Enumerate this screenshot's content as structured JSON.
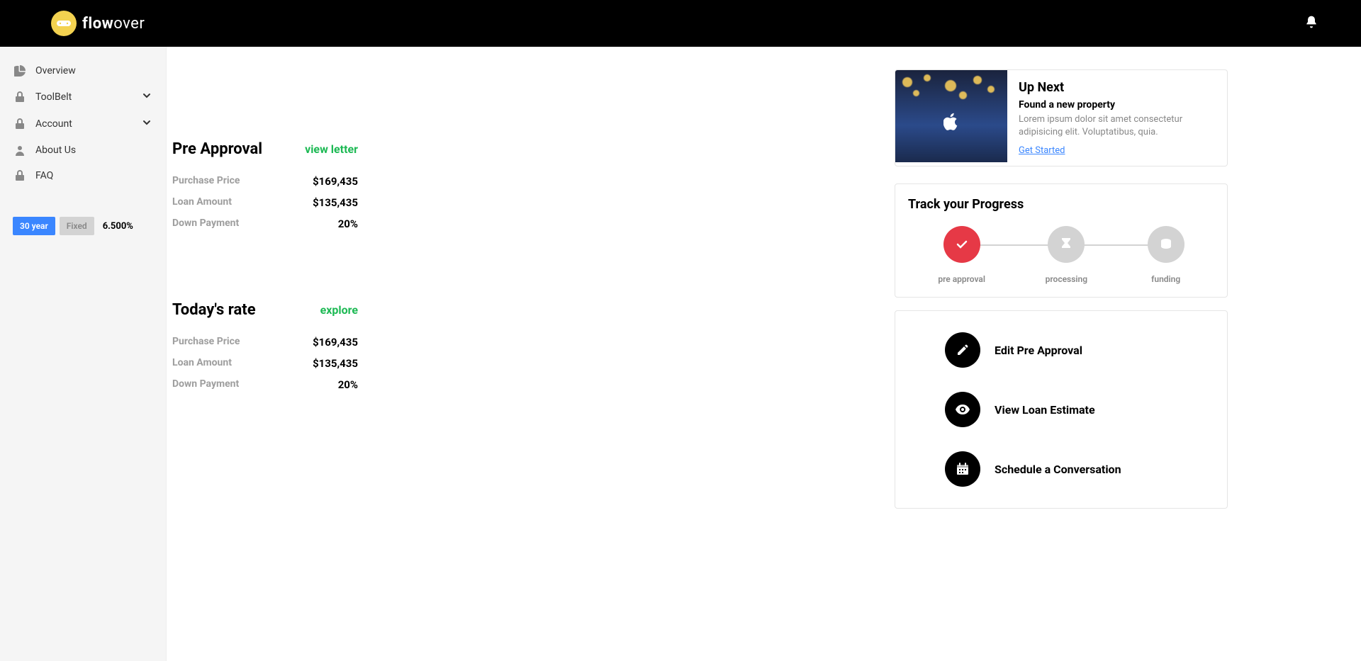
{
  "brand": {
    "name_strong": "flow",
    "name_rest": "over"
  },
  "sidebar": {
    "items": [
      {
        "label": "Overview",
        "icon": "chart-pie-icon",
        "expandable": false
      },
      {
        "label": "ToolBelt",
        "icon": "lock-icon",
        "expandable": true
      },
      {
        "label": "Account",
        "icon": "lock-icon",
        "expandable": true
      },
      {
        "label": "About Us",
        "icon": "user-icon",
        "expandable": false
      },
      {
        "label": "FAQ",
        "icon": "lock-icon",
        "expandable": false
      }
    ],
    "rate": {
      "term": "30 year",
      "type": "Fixed",
      "value": "6.500%"
    }
  },
  "preapproval": {
    "title": "Pre Approval",
    "link": "view letter",
    "rows": [
      {
        "label": "Purchase Price",
        "value": "$169,435"
      },
      {
        "label": "Loan Amount",
        "value": "$135,435"
      },
      {
        "label": "Down Payment",
        "value": "20%"
      }
    ]
  },
  "todays_rate": {
    "title": "Today's rate",
    "link": "explore",
    "rows": [
      {
        "label": "Purchase Price",
        "value": "$169,435"
      },
      {
        "label": "Loan Amount",
        "value": "$135,435"
      },
      {
        "label": "Down Payment",
        "value": "20%"
      }
    ]
  },
  "upnext": {
    "title": "Up Next",
    "subtitle": "Found a new property",
    "desc": "Lorem ipsum dolor sit amet consectetur adipisicing elit. Voluptatibus, quia.",
    "link": "Get Started"
  },
  "progress": {
    "title": "Track your Progress",
    "steps": [
      {
        "label": "pre approval",
        "status": "active",
        "icon": "check-icon"
      },
      {
        "label": "processing",
        "status": "inactive",
        "icon": "hourglass-icon"
      },
      {
        "label": "funding",
        "status": "inactive",
        "icon": "coins-icon"
      }
    ]
  },
  "actions": [
    {
      "label": "Edit Pre Approval",
      "icon": "pencil-icon"
    },
    {
      "label": "View Loan Estimate",
      "icon": "eye-icon"
    },
    {
      "label": "Schedule a Conversation",
      "icon": "calendar-icon"
    }
  ]
}
